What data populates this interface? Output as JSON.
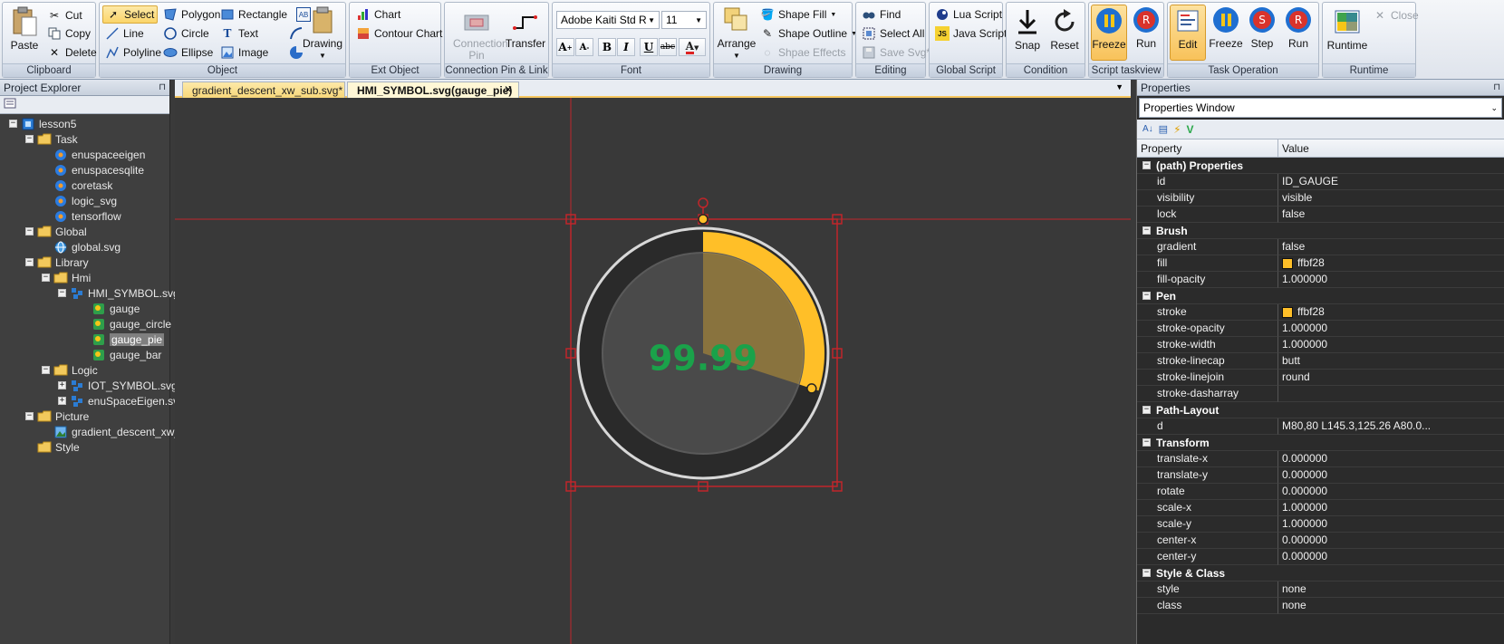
{
  "ribbon": {
    "clipboard": {
      "label": "Clipboard",
      "paste": "Paste",
      "cut": "Cut",
      "copy": "Copy",
      "delete": "Delete"
    },
    "object": {
      "label": "Object",
      "select": "Select",
      "line": "Line",
      "polyline": "Polyline",
      "polygon": "Polygon",
      "circle": "Circle",
      "ellipse": "Ellipse",
      "rectangle": "Rectangle",
      "text": "Text",
      "image": "Image",
      "drawing": "Drawing"
    },
    "ext_object": {
      "label": "Ext Object",
      "chart": "Chart",
      "contour_chart": "Contour Chart"
    },
    "connection": {
      "label": "Connection Pin & Link",
      "pin": "Connection Pin",
      "transfer": "Transfer"
    },
    "font": {
      "label": "Font",
      "family": "Adobe Kaiti Std R",
      "size": "11"
    },
    "drawing": {
      "label": "Drawing",
      "arrange": "Arrange",
      "shape_fill": "Shape Fill",
      "shape_outline": "Shape Outline",
      "shape_effects": "Shpae Effects"
    },
    "editing": {
      "label": "Editing",
      "find": "Find",
      "select_all": "Select All",
      "save_svg": "Save Svg*"
    },
    "global_script": {
      "label": "Global Script",
      "lua": "Lua Script",
      "java": "Java Script"
    },
    "condition": {
      "label": "Condition",
      "snap": "Snap",
      "reset": "Reset"
    },
    "script_taskview": {
      "label": "Script taskview",
      "freeze": "Freeze",
      "run": "Run"
    },
    "task_operation": {
      "label": "Task Operation",
      "edit": "Edit",
      "freeze": "Freeze",
      "step": "Step",
      "run": "Run"
    },
    "runtime": {
      "label": "Runtime",
      "runtime": "Runtime",
      "close": "Close"
    }
  },
  "project_explorer": {
    "title": "Project Explorer",
    "items": [
      {
        "label": "lesson5",
        "level": 0,
        "icon": "project-icon",
        "exp": "−"
      },
      {
        "label": "Task",
        "level": 1,
        "icon": "folder-icon",
        "exp": "−"
      },
      {
        "label": "enuspaceeigen",
        "level": 2,
        "icon": "task-gear-icon"
      },
      {
        "label": "enuspacesqlite",
        "level": 2,
        "icon": "task-gear-icon"
      },
      {
        "label": "coretask",
        "level": 2,
        "icon": "task-gear-icon"
      },
      {
        "label": "logic_svg",
        "level": 2,
        "icon": "task-gear-icon"
      },
      {
        "label": "tensorflow",
        "level": 2,
        "icon": "task-gear-icon"
      },
      {
        "label": "Global",
        "level": 1,
        "icon": "folder-icon",
        "exp": "−"
      },
      {
        "label": "global.svg",
        "level": 2,
        "icon": "globe-icon"
      },
      {
        "label": "Library",
        "level": 1,
        "icon": "folder-icon",
        "exp": "−"
      },
      {
        "label": "Hmi",
        "level": 2,
        "icon": "folder-icon",
        "exp": "−"
      },
      {
        "label": "HMI_SYMBOL.svg",
        "level": 3,
        "icon": "symbol-file-icon",
        "exp": "−"
      },
      {
        "label": "gauge",
        "level": 4,
        "icon": "symbol-icon"
      },
      {
        "label": "gauge_circle",
        "level": 4,
        "icon": "symbol-icon"
      },
      {
        "label": "gauge_pie",
        "level": 4,
        "icon": "symbol-icon",
        "selected": true
      },
      {
        "label": "gauge_bar",
        "level": 4,
        "icon": "symbol-icon"
      },
      {
        "label": "Logic",
        "level": 2,
        "icon": "folder-icon",
        "exp": "−"
      },
      {
        "label": "IOT_SYMBOL.svg",
        "level": 3,
        "icon": "symbol-file-icon",
        "exp": "+"
      },
      {
        "label": "enuSpaceEigen.svg",
        "level": 3,
        "icon": "symbol-file-icon",
        "exp": "+"
      },
      {
        "label": "Picture",
        "level": 1,
        "icon": "folder-icon",
        "exp": "−"
      },
      {
        "label": "gradient_descent_xw_s",
        "level": 2,
        "icon": "picture-icon"
      },
      {
        "label": "Style",
        "level": 1,
        "icon": "folder-icon"
      }
    ]
  },
  "tabs": [
    {
      "label": "gradient_descent_xw_sub.svg*",
      "active": false
    },
    {
      "label": "HMI_SYMBOL.svg(gauge_pie)",
      "active": true
    }
  ],
  "gauge": {
    "value_text": "99.99",
    "percent": 0.3,
    "color": "#ffbf28",
    "text_color": "#1aa24a"
  },
  "properties": {
    "title": "Properties",
    "selector": "Properties Window",
    "col_property": "Property",
    "col_value": "Value",
    "sections": [
      {
        "name": "(path) Properties",
        "rows": [
          {
            "key": "id",
            "value": "ID_GAUGE"
          },
          {
            "key": "visibility",
            "value": "visible"
          },
          {
            "key": "lock",
            "value": "false"
          }
        ]
      },
      {
        "name": "Brush",
        "rows": [
          {
            "key": "gradient",
            "value": "false"
          },
          {
            "key": "fill",
            "value": "ffbf28",
            "swatch": "#ffbf28"
          },
          {
            "key": "fill-opacity",
            "value": "1.000000"
          }
        ]
      },
      {
        "name": "Pen",
        "rows": [
          {
            "key": "stroke",
            "value": "ffbf28",
            "swatch": "#ffbf28"
          },
          {
            "key": "stroke-opacity",
            "value": "1.000000"
          },
          {
            "key": "stroke-width",
            "value": "1.000000"
          },
          {
            "key": "stroke-linecap",
            "value": "butt"
          },
          {
            "key": "stroke-linejoin",
            "value": "round"
          },
          {
            "key": "stroke-dasharray",
            "value": ""
          }
        ]
      },
      {
        "name": "Path-Layout",
        "rows": [
          {
            "key": "d",
            "value": "M80,80 L145.3,125.26 A80.0..."
          }
        ]
      },
      {
        "name": "Transform",
        "rows": [
          {
            "key": "translate-x",
            "value": "0.000000"
          },
          {
            "key": "translate-y",
            "value": "0.000000"
          },
          {
            "key": "rotate",
            "value": "0.000000"
          },
          {
            "key": "scale-x",
            "value": "1.000000"
          },
          {
            "key": "scale-y",
            "value": "1.000000"
          },
          {
            "key": "center-x",
            "value": "0.000000"
          },
          {
            "key": "center-y",
            "value": "0.000000"
          }
        ]
      },
      {
        "name": "Style & Class",
        "rows": [
          {
            "key": "style",
            "value": "none"
          },
          {
            "key": "class",
            "value": "none"
          }
        ]
      }
    ]
  }
}
